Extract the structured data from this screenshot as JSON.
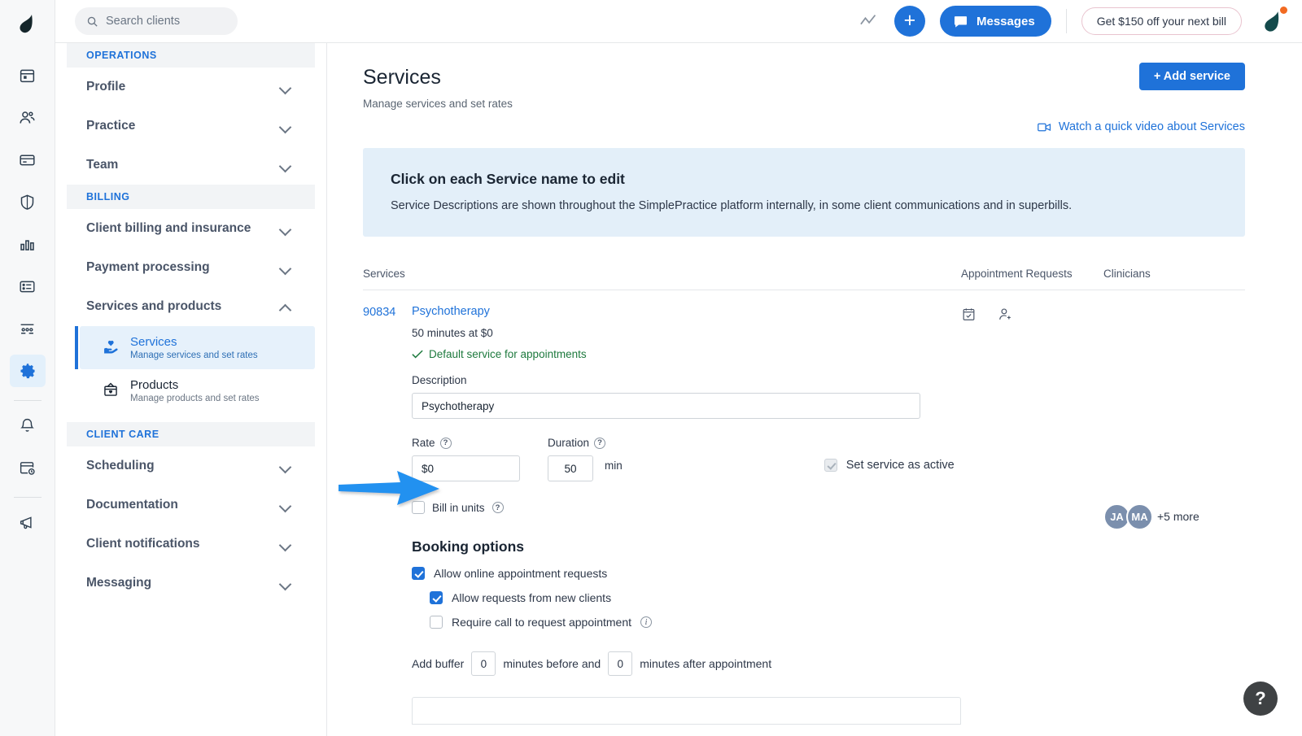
{
  "topbar": {
    "search": {
      "placeholder": "Search clients",
      "icon": "search-icon"
    },
    "trend_icon": "trend-line-icon",
    "add_label": "+",
    "messages_label": "Messages",
    "promo_label": "Get $150 off your next bill",
    "account_icon": "simplepractice-leaf-avatar"
  },
  "icon_rail": {
    "logo": "simplepractice-logo",
    "items": [
      {
        "name": "calendar-icon",
        "active": false
      },
      {
        "name": "clients-icon",
        "active": false
      },
      {
        "name": "billing-card-icon",
        "active": false
      },
      {
        "name": "insurance-shield-icon",
        "active": false
      },
      {
        "name": "analytics-bars-icon",
        "active": false
      },
      {
        "name": "notes-list-icon",
        "active": false
      },
      {
        "name": "group-icon",
        "active": false
      },
      {
        "name": "settings-gear-icon",
        "active": true
      },
      {
        "name": "notifications-bell-icon",
        "active": false
      },
      {
        "name": "calendar-clock-icon",
        "active": false
      },
      {
        "name": "megaphone-icon",
        "active": false
      }
    ]
  },
  "settings_nav": {
    "sections": [
      {
        "label": "OPERATIONS",
        "rows": [
          {
            "label": "Profile",
            "expanded": false
          },
          {
            "label": "Practice",
            "expanded": false
          },
          {
            "label": "Team",
            "expanded": false
          }
        ]
      },
      {
        "label": "BILLING",
        "rows": [
          {
            "label": "Client billing and insurance",
            "expanded": false
          },
          {
            "label": "Payment processing",
            "expanded": false
          },
          {
            "label": "Services and products",
            "expanded": true
          }
        ],
        "sub_items": [
          {
            "title": "Services",
            "subtitle": "Manage services and set rates",
            "icon": "hand-heart-icon",
            "active": true
          },
          {
            "title": "Products",
            "subtitle": "Manage products and set rates",
            "icon": "box-heart-icon",
            "active": false
          }
        ]
      },
      {
        "label": "CLIENT CARE",
        "rows": [
          {
            "label": "Scheduling",
            "expanded": false
          },
          {
            "label": "Documentation",
            "expanded": false
          },
          {
            "label": "Client notifications",
            "expanded": false
          },
          {
            "label": "Messaging",
            "expanded": false
          }
        ]
      }
    ]
  },
  "page": {
    "title": "Services",
    "subtitle": "Manage services and set rates",
    "add_service_label": "+ Add service",
    "watch_video_label": "Watch a quick video about Services",
    "watch_video_icon": "video-camera-icon"
  },
  "banner": {
    "title": "Click on each Service name to edit",
    "body": "Service Descriptions are shown throughout the SimplePractice platform internally, in some client communications and in superbills."
  },
  "table": {
    "headers": {
      "services": "Services",
      "appointment_requests": "Appointment Requests",
      "clinicians": "Clinicians"
    }
  },
  "service": {
    "code": "90834",
    "name": "Psychotherapy",
    "meta": "50 minutes at $0",
    "default_label": "Default service for appointments",
    "default_icon": "check-icon",
    "description_label": "Description",
    "description_value": "Psychotherapy",
    "rate_label": "Rate",
    "rate_value": "$0",
    "duration_label": "Duration",
    "duration_value": "50",
    "duration_unit": "min",
    "set_active_label": "Set service as active",
    "set_active_checked": true,
    "set_active_disabled": true,
    "bill_units_label": "Bill in units",
    "bill_units_checked": false,
    "appt_request_icons": [
      "calendar-check-icon",
      "person-add-icon"
    ],
    "clinicians": [
      {
        "initials": "JA"
      },
      {
        "initials": "MA"
      }
    ],
    "clinicians_more": "+5 more"
  },
  "booking": {
    "heading": "Booking options",
    "options": [
      {
        "label": "Allow online appointment requests",
        "checked": true,
        "indent": false,
        "info": false
      },
      {
        "label": "Allow requests from new clients",
        "checked": true,
        "indent": true,
        "info": false
      },
      {
        "label": "Require call to request appointment",
        "checked": false,
        "indent": true,
        "info": true
      }
    ],
    "buffer": {
      "prefix": "Add buffer",
      "before_value": "0",
      "middle": "minutes before and",
      "after_value": "0",
      "suffix": "minutes after appointment"
    }
  },
  "annotation": {
    "arrow": "blue-arrow-pointing-right",
    "color": "#2291f0",
    "target": "rate-input"
  },
  "help_fab": {
    "label": "?",
    "icon": "question-mark-icon"
  },
  "colors": {
    "brand_blue": "#1f72d9",
    "banner_bg": "#e3eff9",
    "green": "#1e7a3e",
    "avatar": "#7b8fad",
    "rail_bg": "#f7f8f9"
  }
}
